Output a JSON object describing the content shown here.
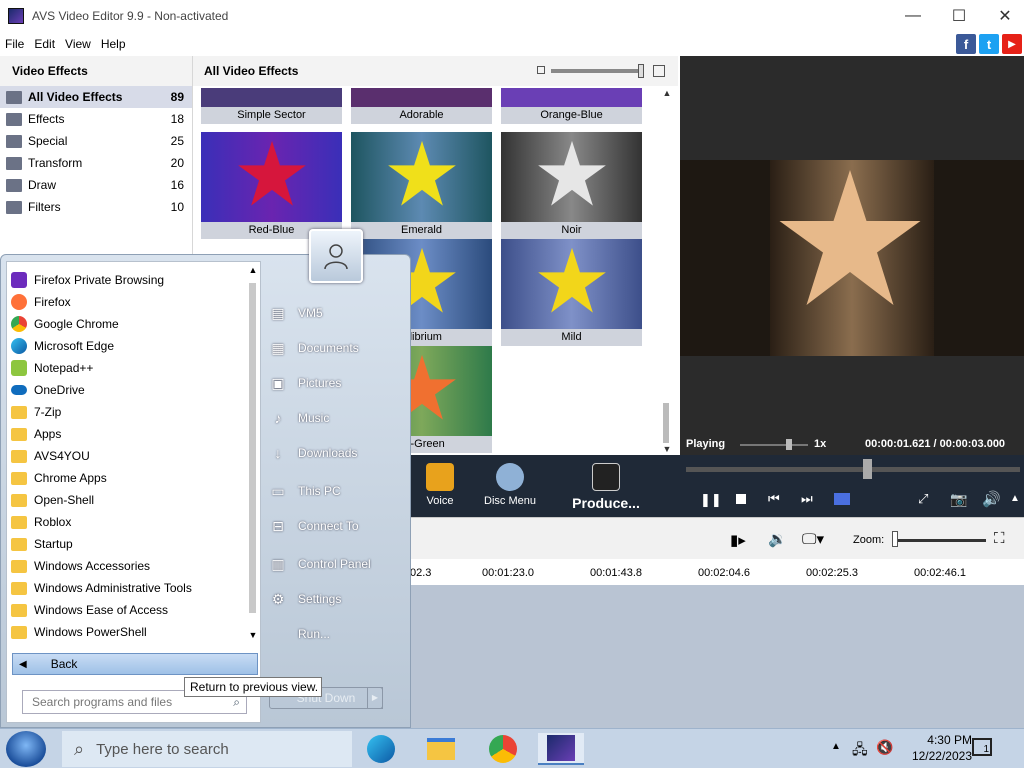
{
  "window": {
    "title": "AVS Video Editor 9.9 - Non-activated"
  },
  "menu": [
    "File",
    "Edit",
    "View",
    "Help"
  ],
  "social": [
    "f",
    "t",
    "▶"
  ],
  "categories": {
    "header": "Video Effects",
    "items": [
      {
        "label": "All Video Effects",
        "count": "89"
      },
      {
        "label": "Effects",
        "count": "18"
      },
      {
        "label": "Special",
        "count": "25"
      },
      {
        "label": "Transform",
        "count": "20"
      },
      {
        "label": "Draw",
        "count": "16"
      },
      {
        "label": "Filters",
        "count": "10"
      }
    ]
  },
  "effects": {
    "header": "All Video Effects",
    "items": [
      {
        "label": "Simple Sector"
      },
      {
        "label": "Adorable"
      },
      {
        "label": "Orange-Blue"
      },
      {
        "label": "Red-Blue"
      },
      {
        "label": "Emerald"
      },
      {
        "label": "Noir"
      },
      {
        "label": "uilibrium"
      },
      {
        "label": "Mild"
      },
      {
        "label": "ge-Green"
      }
    ]
  },
  "preview": {
    "state": "Playing",
    "speed": "1x",
    "time": "00:00:01.621 / 00:00:03.000"
  },
  "toolbar": {
    "voice": "Voice",
    "disc_menu": "Disc Menu",
    "produce": "Produce..."
  },
  "timeline": {
    "zoom_label": "Zoom:",
    "ticks": [
      "02.3",
      "00:01:23.0",
      "00:01:43.8",
      "00:02:04.6",
      "00:02:25.3",
      "00:02:46.1"
    ]
  },
  "startmenu": {
    "programs": [
      {
        "label": "Firefox Private Browsing",
        "icon": "firefox-private-icon",
        "color": "#6c2bbd"
      },
      {
        "label": "Firefox",
        "icon": "firefox-icon",
        "color": "#ff7139"
      },
      {
        "label": "Google Chrome",
        "icon": "chrome-icon",
        "color": "#34a853"
      },
      {
        "label": "Microsoft Edge",
        "icon": "edge-icon",
        "color": "#0c8bd8"
      },
      {
        "label": "Notepad++",
        "icon": "notepadpp-icon",
        "color": "#8dc63f"
      },
      {
        "label": "OneDrive",
        "icon": "onedrive-icon",
        "color": "#0f6cbd"
      },
      {
        "label": "7-Zip",
        "icon": "folder-icon"
      },
      {
        "label": "Apps",
        "icon": "folder-icon"
      },
      {
        "label": "AVS4YOU",
        "icon": "folder-icon"
      },
      {
        "label": "Chrome Apps",
        "icon": "folder-icon"
      },
      {
        "label": "Open-Shell",
        "icon": "folder-icon"
      },
      {
        "label": "Roblox",
        "icon": "folder-icon"
      },
      {
        "label": "Startup",
        "icon": "folder-icon"
      },
      {
        "label": "Windows Accessories",
        "icon": "folder-icon"
      },
      {
        "label": "Windows Administrative Tools",
        "icon": "folder-icon"
      },
      {
        "label": "Windows Ease of Access",
        "icon": "folder-icon"
      },
      {
        "label": "Windows PowerShell",
        "icon": "folder-icon"
      }
    ],
    "back": "Back",
    "search_placeholder": "Search programs and files",
    "tooltip": "Return to previous view.",
    "places": [
      {
        "label": "VM5",
        "icon": "user-folder-icon"
      },
      {
        "label": "Documents",
        "icon": "documents-icon"
      },
      {
        "label": "Pictures",
        "icon": "pictures-icon"
      },
      {
        "label": "Music",
        "icon": "music-icon"
      },
      {
        "label": "Downloads",
        "icon": "downloads-icon"
      },
      {
        "label": "This PC",
        "icon": "this-pc-icon"
      },
      {
        "label": "Connect To",
        "icon": "connect-to-icon"
      },
      {
        "label": "Control Panel",
        "icon": "control-panel-icon"
      },
      {
        "label": "Settings",
        "icon": "settings-icon"
      },
      {
        "label": "Run...",
        "icon": "run-icon"
      }
    ],
    "shutdown": "Shut Down"
  },
  "taskbar": {
    "search_placeholder": "Type here to search",
    "time": "4:30 PM",
    "date": "12/22/2023",
    "notifications": "1"
  }
}
